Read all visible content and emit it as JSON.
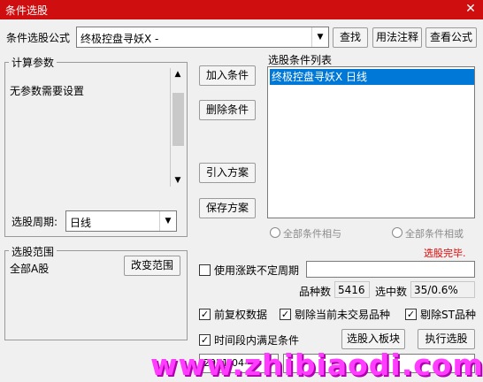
{
  "window": {
    "title": "条件选股"
  },
  "formula": {
    "label": "条件选股公式",
    "value": "终极控盘寻妖X  -",
    "btn_find": "查找",
    "btn_usage": "用法注释",
    "btn_view": "查看公式"
  },
  "params": {
    "group_title": "计算参数",
    "text": "无参数需要设置",
    "period_label": "选股周期:",
    "period_value": "日线"
  },
  "actions": {
    "add": "加入条件",
    "delete": "删除条件",
    "import": "引入方案",
    "save": "保存方案"
  },
  "conditions": {
    "list_title": "选股条件列表",
    "items": [
      "终极控盘寻妖X  日线"
    ],
    "radio_and": "全部条件相与",
    "radio_or": "全部条件相或"
  },
  "status": {
    "done": "选股完毕."
  },
  "scope": {
    "group_title": "选股范围",
    "value": "全部A股",
    "change_btn": "改变范围"
  },
  "options": {
    "irregular_period": "使用涨跌不定周期",
    "stock_count_label": "品种数",
    "stock_count_value": "5416",
    "selected_label": "选中数",
    "selected_value": "35/0.6%",
    "pre_adjust": "前复权数据",
    "exclude_no_trade": "剔除当前未交易品种",
    "exclude_st": "剔除ST品种",
    "time_range": "时间段内满足条件",
    "date_partial": "2021-04-"
  },
  "bottom": {
    "to_block": "选股入板块",
    "execute": "执行选股"
  },
  "watermark": "www.zhibiaodi.com",
  "colors": {
    "titlebar": "#cf0f0f",
    "selection": "#0078d7",
    "status": "#e00000",
    "watermark": "#ff3cff"
  }
}
